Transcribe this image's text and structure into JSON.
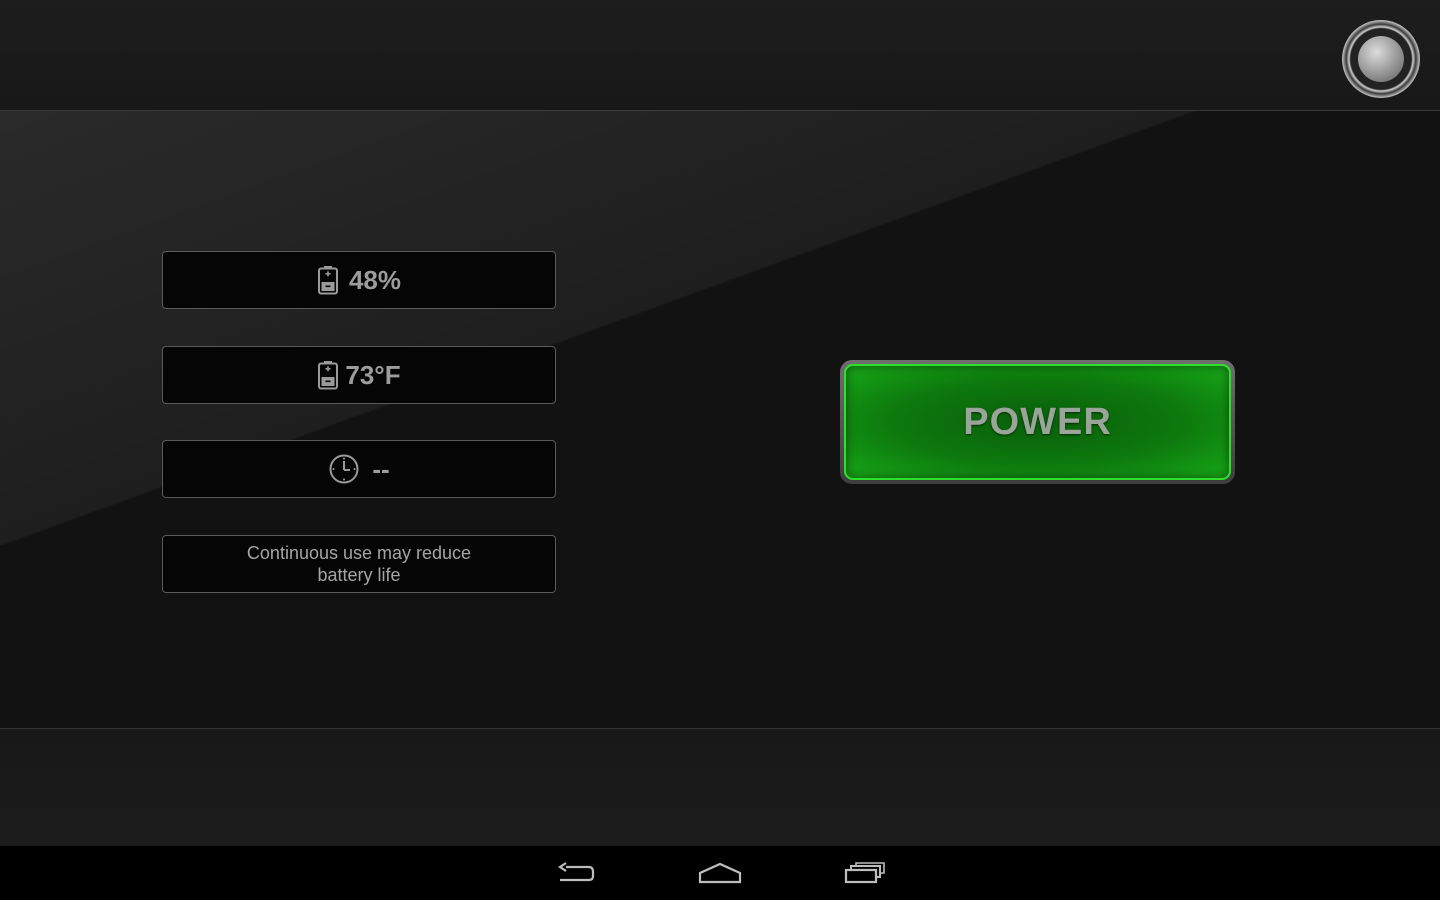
{
  "status": {
    "battery_level": "48%",
    "temperature": "73°F",
    "time_remaining": "--",
    "warning": "Continuous use may reduce battery life"
  },
  "controls": {
    "power_label": "POWER"
  },
  "icons": {
    "battery": "battery-icon",
    "clock": "clock-icon",
    "gear": "gear-icon",
    "back": "back-icon",
    "home": "home-icon",
    "recents": "recent-apps-icon"
  },
  "colors": {
    "power_green": "#0d7a0d",
    "power_border": "#2ce02c",
    "background": "#121212"
  }
}
